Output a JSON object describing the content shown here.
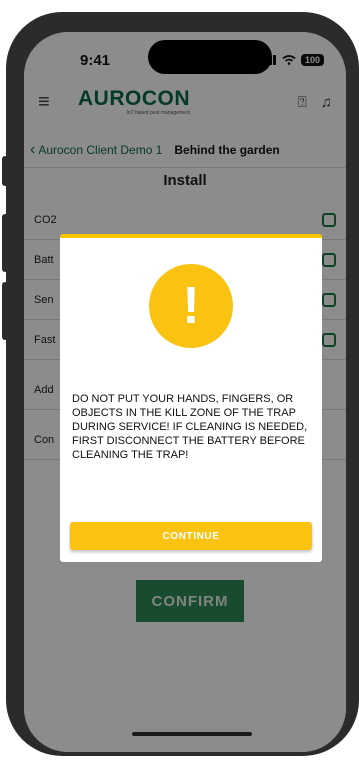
{
  "status_bar": {
    "time": "9:41",
    "battery": "100"
  },
  "header": {
    "logo": "AUROCON",
    "tagline": "IoT based pest management"
  },
  "breadcrumb": {
    "back_label": "Aurocon Client Demo 1",
    "current": "Behind the garden"
  },
  "page": {
    "title": "Install"
  },
  "rows": [
    {
      "label": "CO2"
    },
    {
      "label": "Batt"
    },
    {
      "label": "Sen"
    },
    {
      "label": "Fast"
    },
    {
      "label": "Add"
    },
    {
      "label": "Con"
    }
  ],
  "confirm_label": "CONFIRM",
  "modal": {
    "message": "DO NOT PUT YOUR HANDS, FINGERS, OR OBJECTS IN THE KILL ZONE OF THE TRAP DURING SERVICE! IF CLEANING IS NEEDED, FIRST DISCONNECT THE BATTERY BEFORE CLEANING THE TRAP!",
    "continue_label": "CONTINUE",
    "icon_glyph": "!"
  },
  "colors": {
    "brand": "#0b6b4a",
    "warning": "#fbc311",
    "confirm": "#2f8a55"
  }
}
